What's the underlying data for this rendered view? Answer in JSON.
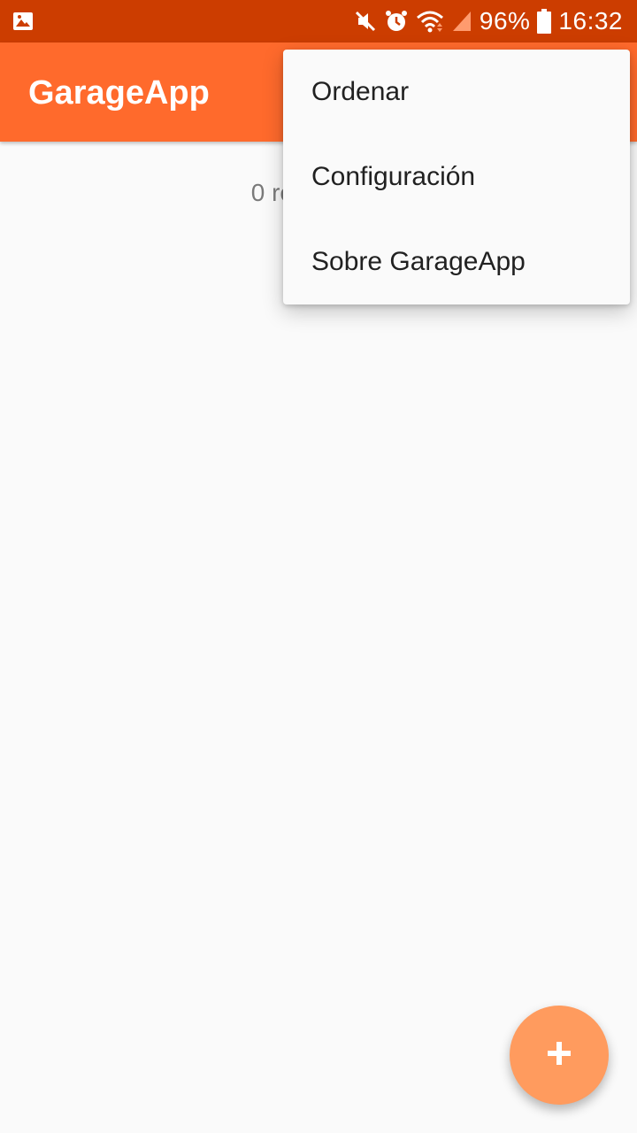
{
  "status_bar": {
    "left_icon": "image-notification-icon",
    "icons": [
      "mute-icon",
      "alarm-icon",
      "wifi-icon",
      "signal-icon",
      "battery-icon"
    ],
    "battery": "96%",
    "time": "16:32",
    "color": "#cc3d00"
  },
  "app_bar": {
    "title": "GarageApp",
    "color": "#ff6a2c"
  },
  "main": {
    "results_text": "0 resultados"
  },
  "overflow_menu": {
    "items": [
      {
        "label": "Ordenar"
      },
      {
        "label": "Configuración"
      },
      {
        "label": "Sobre GarageApp"
      }
    ]
  },
  "fab": {
    "icon": "add-icon",
    "color": "#ff9b5e"
  }
}
